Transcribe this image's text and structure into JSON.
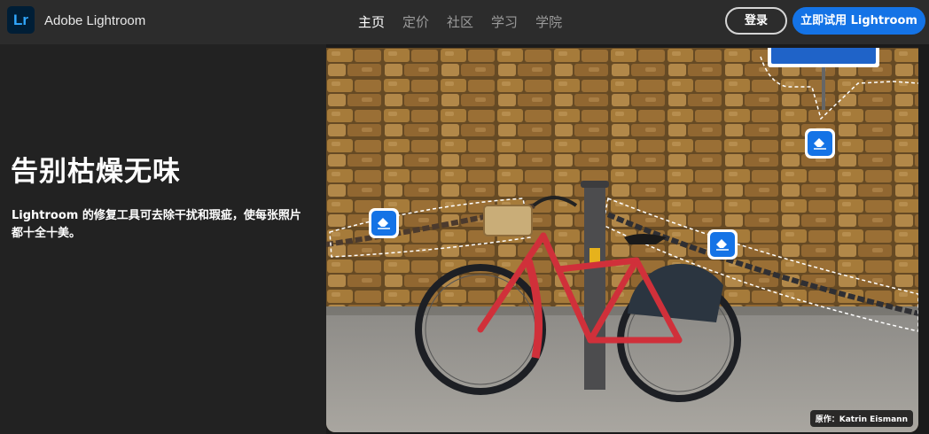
{
  "header": {
    "logo_text": "Lr",
    "brand": "Adobe Lightroom",
    "nav": [
      "主页",
      "定价",
      "社区",
      "学习",
      "学院"
    ],
    "login_label": "登录",
    "try_label": "立即试用 Lightroom"
  },
  "hero": {
    "headline": "告别枯燥无味",
    "description": "Lightroom 的修复工具可去除干扰和瑕疵，使每张照片都十全十美。",
    "credit": "原作：Katrin Eismann",
    "heal_buttons": [
      {
        "icon": "eraser-icon"
      },
      {
        "icon": "eraser-icon"
      },
      {
        "icon": "eraser-icon"
      }
    ]
  },
  "colors": {
    "accent": "#1473e6",
    "topbar": "#2c2c2c",
    "background": "#222222",
    "bicycle": "#d0303a"
  }
}
